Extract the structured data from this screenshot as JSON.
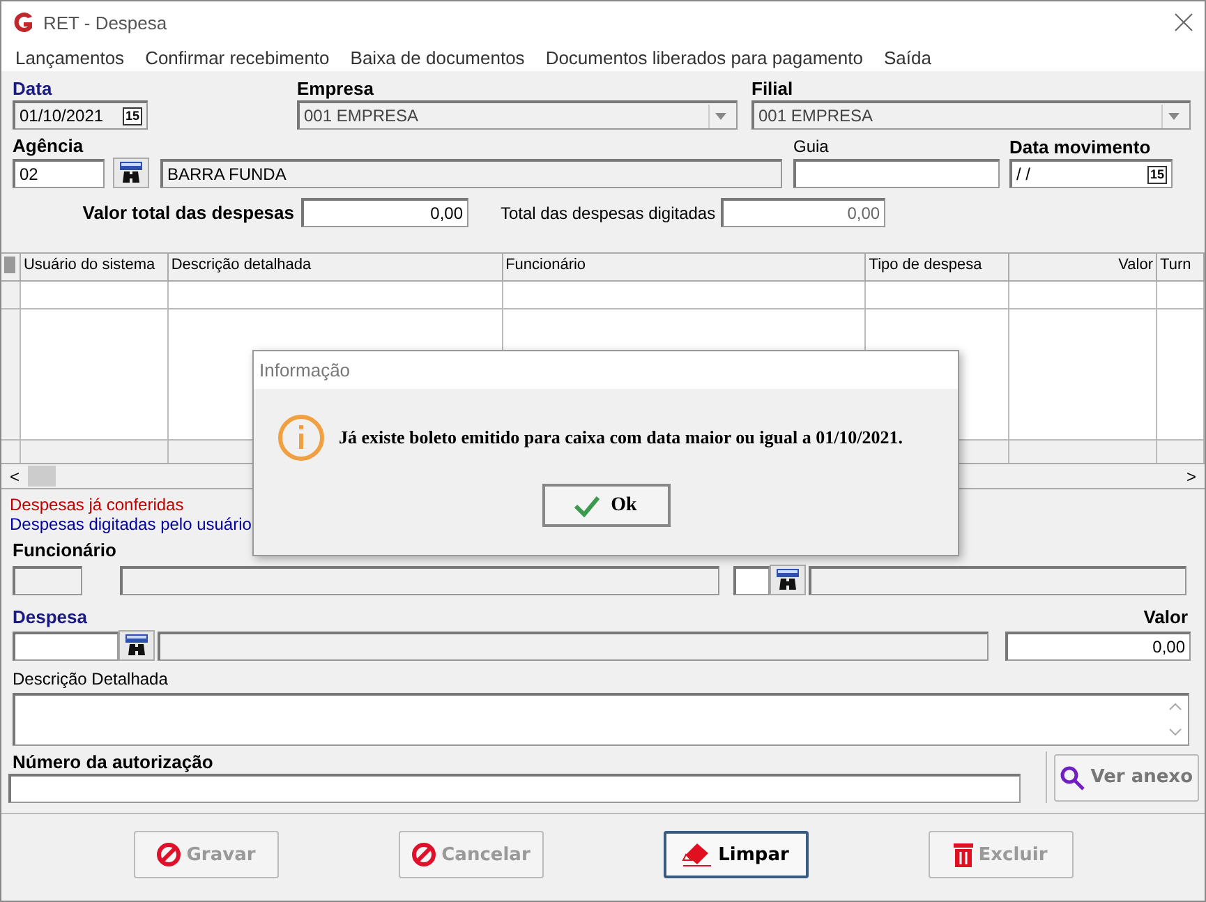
{
  "window": {
    "title": "RET - Despesa"
  },
  "menu": [
    "Lançamentos",
    "Confirmar recebimento",
    "Baixa de documentos",
    "Documentos liberados para pagamento",
    "Saída"
  ],
  "header": {
    "data": {
      "label": "Data",
      "value": "01/10/2021",
      "calendar": "15"
    },
    "empresa": {
      "label": "Empresa",
      "value": "001 EMPRESA"
    },
    "filial": {
      "label": "Filial",
      "value": "001 EMPRESA"
    },
    "agencia": {
      "label": "Agência",
      "code": "02",
      "name": "BARRA FUNDA"
    },
    "guia": {
      "label": "Guia"
    },
    "data_movimento": {
      "label": "Data movimento",
      "value": " / /",
      "calendar": "15"
    },
    "valor_total": {
      "label": "Valor total das despesas",
      "value": "0,00"
    },
    "total_digitadas": {
      "label": "Total das despesas digitadas",
      "value": "0,00"
    }
  },
  "table": {
    "columns": [
      "Usuário do sistema",
      "Descrição detalhada",
      "Funcionário",
      "Tipo de despesa",
      "Valor",
      "Turn"
    ],
    "scroll_left": "<",
    "scroll_right": ">"
  },
  "legend": [
    {
      "text": "Despesas já conferidas",
      "color": "#c00000"
    },
    {
      "text": "Despesas digitadas pelo usuário",
      "color": "#0000a0"
    }
  ],
  "form": {
    "funcionario": {
      "label": "Funcionário"
    },
    "despesa": {
      "label": "Despesa"
    },
    "valor": {
      "label": "Valor",
      "value": "0,00"
    },
    "descricao": {
      "label": "Descrição Detalhada"
    },
    "autorizacao": {
      "label": "Número da autorização"
    },
    "ver_anexo": "Ver anexo"
  },
  "buttons": [
    {
      "label": "Gravar",
      "kind": "forbid",
      "disabled": true
    },
    {
      "label": "Cancelar",
      "kind": "forbid",
      "disabled": true
    },
    {
      "label": "Limpar",
      "kind": "eraser",
      "disabled": false
    },
    {
      "label": "Excluir",
      "kind": "trash",
      "disabled": true
    }
  ],
  "dialog": {
    "title": "Informação",
    "message": "Já existe boleto emitido para caixa com data maior ou igual a 01/10/2021.",
    "button": "Ok"
  }
}
